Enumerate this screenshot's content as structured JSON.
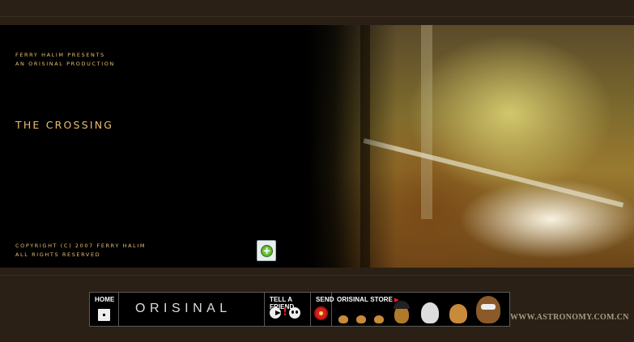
{
  "credits": {
    "presenter": "FERRY  HALIM  PRESENTS",
    "production": "AN  ORISINAL  PRODUCTION",
    "title": "THE CROSSING",
    "copyright": "COPYRIGHT (C) 2007 FERRY  HALIM",
    "rights": "ALL RIGHTS RESERVED"
  },
  "zoom_button": {
    "glyph": "+"
  },
  "navbar": {
    "home_label": "HOME",
    "logo_text": "ORISINAL",
    "tell_label": "TELL A FRIEND",
    "tell_excl": "!",
    "send_label": "SEND",
    "store_label": "ORISINAL STORE",
    "store_arrow": "▶"
  },
  "watermark": "WWW.ASTRONOMY.COM.CN",
  "icons": {
    "home": "home-square-icon",
    "tell": [
      "pacman-icon",
      "exclamation-icon",
      "smiley-icon"
    ],
    "send": "flower-icon",
    "store": [
      "bird-icon",
      "bird-icon",
      "bird-icon",
      "umbrella-critter-icon",
      "cat-icon",
      "squirrel-icon",
      "raccoon-icon"
    ]
  },
  "colors": {
    "credit_text": "#e8c070",
    "background": "#2a2016",
    "accent_red": "#e02020"
  }
}
